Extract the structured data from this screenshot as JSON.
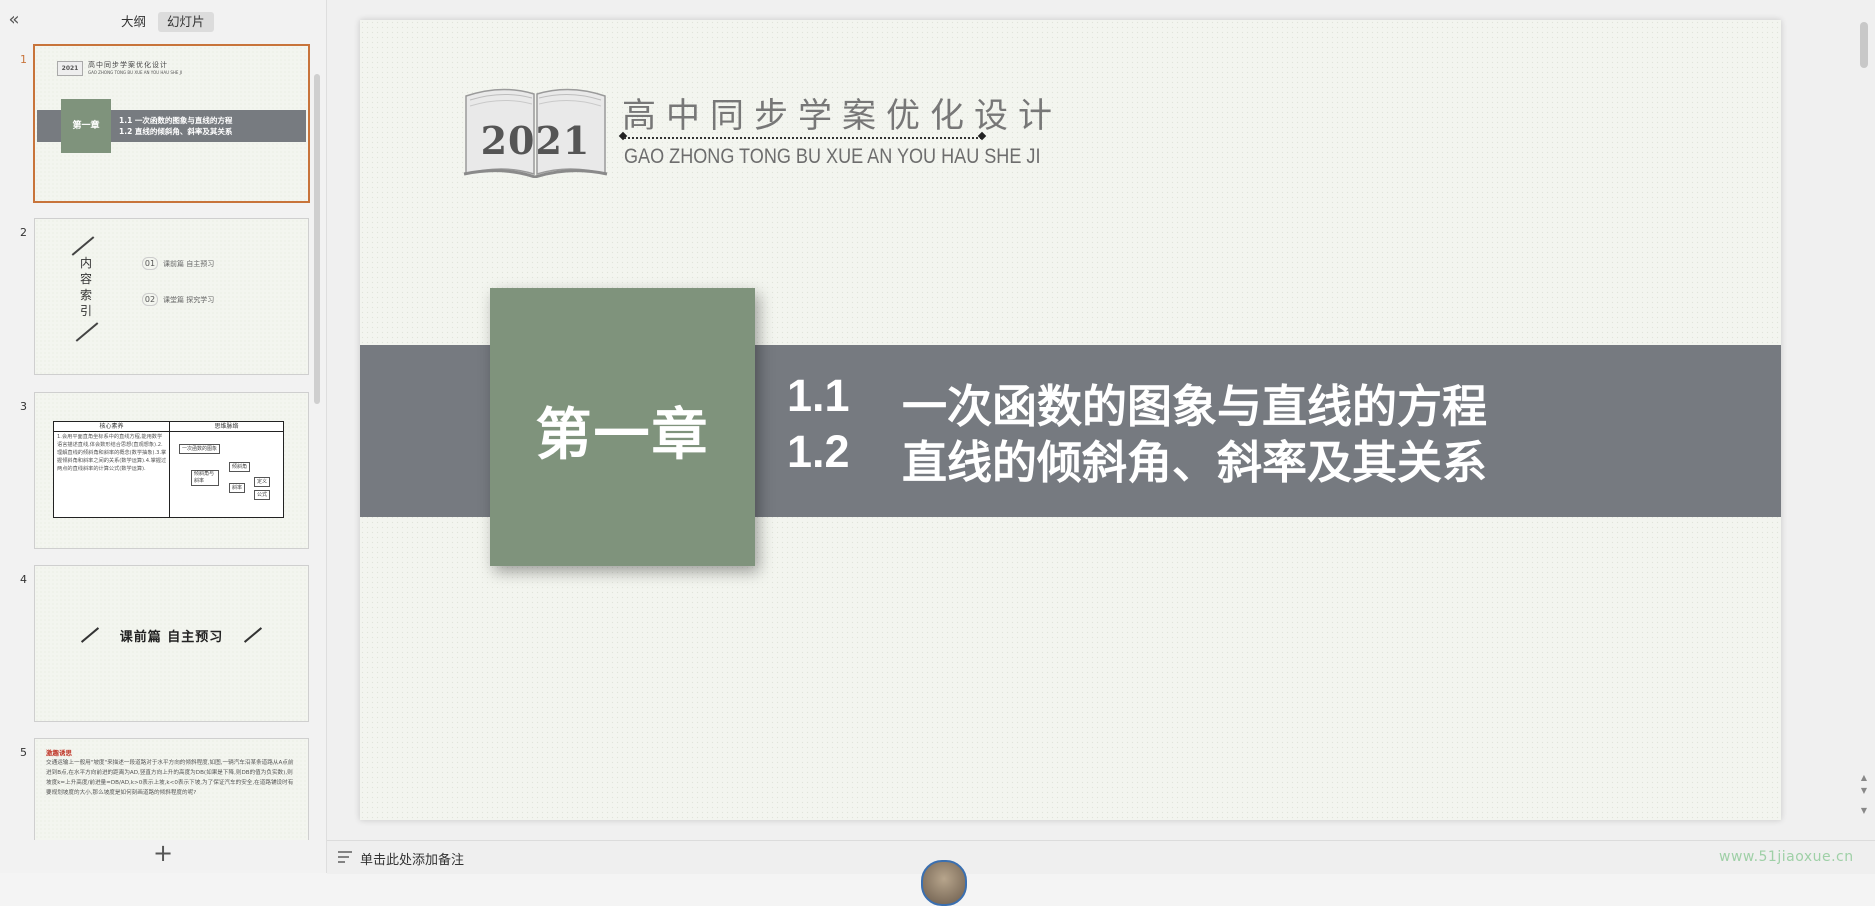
{
  "left_panel": {
    "collapse_label": "«",
    "tabs": [
      {
        "label": "大纲"
      },
      {
        "label": "幻灯片"
      }
    ],
    "add_label": "+",
    "thumbnails": [
      {
        "number": "1",
        "year": "2021",
        "title": "高中同步学案优化设计",
        "subtitle": "GAO ZHONG TONG BU XUE AN YOU HAU SHE JI",
        "chapter": "第一章",
        "line1": "1.1   一次函数的图象与直线的方程",
        "line2": "1.2   直线的倾斜角、斜率及其关系"
      },
      {
        "number": "2",
        "vertical_text": [
          "内",
          "容",
          "索",
          "引"
        ],
        "items": [
          {
            "num": "01",
            "text": "课前篇  自主预习"
          },
          {
            "num": "02",
            "text": "课堂篇  探究学习"
          }
        ]
      },
      {
        "number": "3",
        "col1_header": "核心素养",
        "col2_header": "思维脉络",
        "col1_text": "1.会用平面直角坐标系中的直线方程,能用数学语言描述直线,体会数形结合思想(直观想象).2.理解直线的倾斜角和斜率的概念(数学抽象).3.掌握倾斜角和斜率之间的关系(数学运算).4.掌握过两点的直线斜率的计算公式(数学运算).",
        "node_1": "一次函数的图象",
        "node_2": "倾斜角",
        "node_3": "倾斜角与斜率",
        "node_4": "斜率",
        "node_5": "定义",
        "node_6": "公式"
      },
      {
        "number": "4",
        "text": "课前篇  自主预习"
      },
      {
        "number": "5",
        "heading": "激趣诱思",
        "body": "交通运输上一般用\"坡度\"来描述一段道路对于水平方向的倾斜程度,如图,一辆汽车沿某条道路从A点前进到B点,在水平方向前进的距离为AD,竖直方向上升的高度为DB(如果是下降,则DB的值为负实数),则坡度k=上升高度/前进量=DB/AD,k>0表示上坡,k<0表示下坡,为了保证汽车的安全,在道路铺设时有要规划坡度的大小,那么坡度是如何刻画道路的倾斜程度的呢?"
      }
    ]
  },
  "slide": {
    "book_year": "2021",
    "brand_title": "高中同步学案优化设计",
    "brand_pinyin": "GAO ZHONG TONG BU XUE AN YOU HAU SHE JI",
    "chapter": "第一章",
    "sections": [
      {
        "num": "1.1",
        "title": "一次函数的图象与直线的方程"
      },
      {
        "num": "1.2",
        "title": "直线的倾斜角、斜率及其关系"
      }
    ]
  },
  "notes_bar": {
    "placeholder": "单击此处添加备注"
  },
  "watermark": "www.51jiaoxue.cn",
  "colors": {
    "band_gray": "#767a80",
    "chapter_green": "#7f937c",
    "active_thumb_border": "#c8743b"
  }
}
